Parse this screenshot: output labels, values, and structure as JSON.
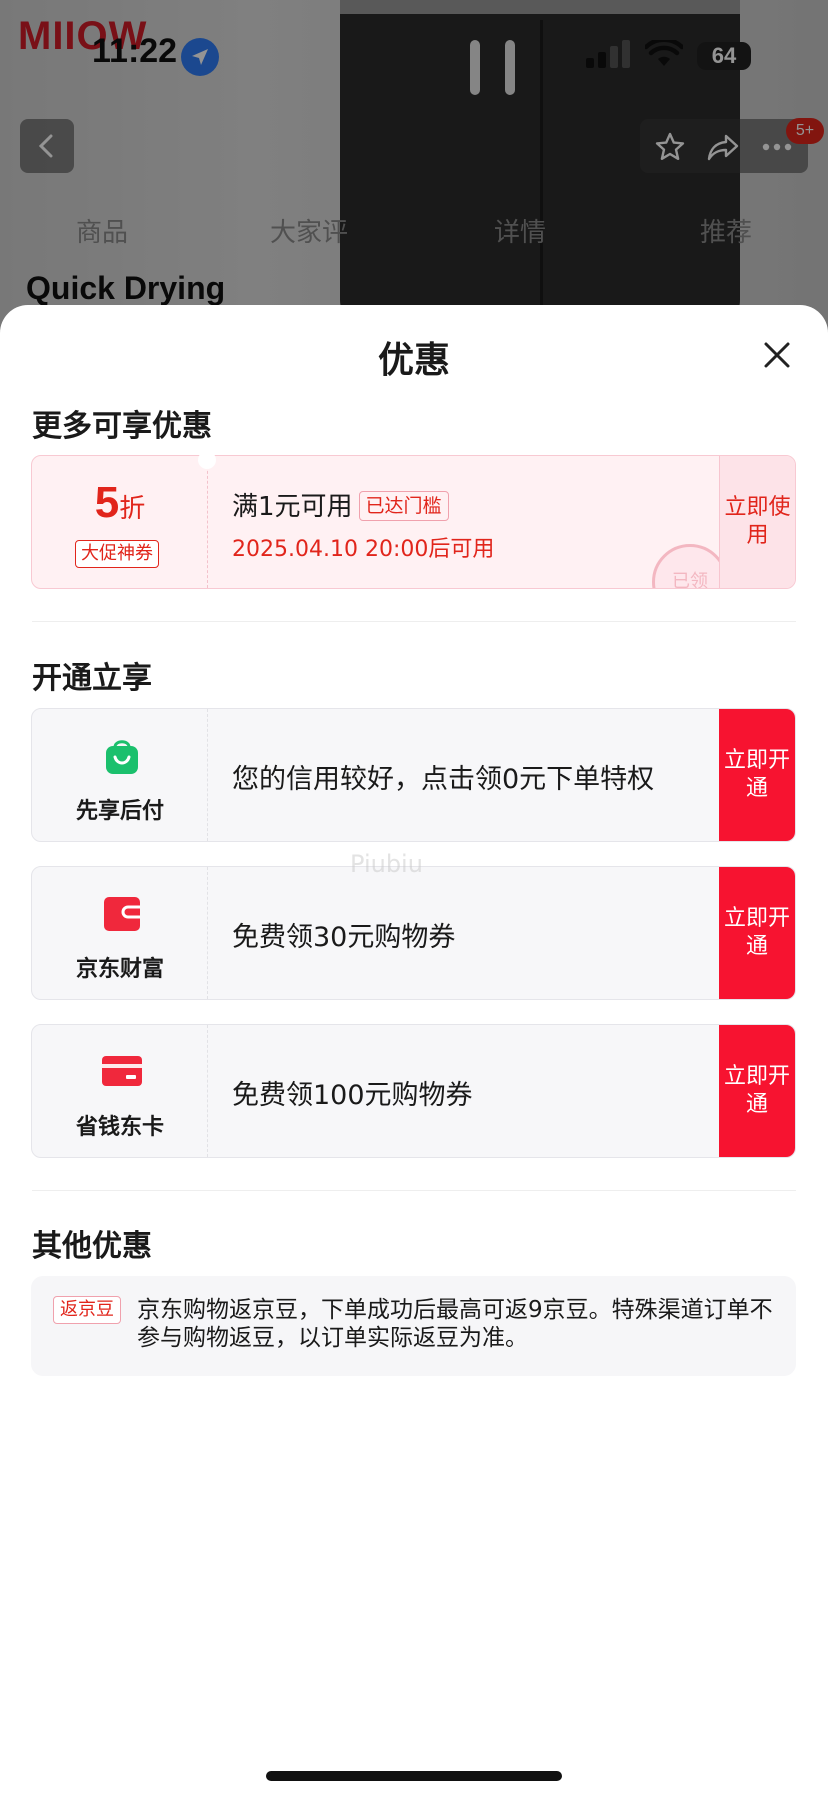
{
  "status_bar": {
    "time": "11:22",
    "battery": "64"
  },
  "background_page": {
    "logo": "MIIOW",
    "tabs": [
      "商品",
      "大家评",
      "详情",
      "推荐"
    ],
    "product_caption": "Quick Drying",
    "cart_badge": "5+"
  },
  "sheet": {
    "title": "优惠",
    "sections": {
      "more_title": "更多可享优惠",
      "open_title": "开通立享",
      "other_title": "其他优惠"
    },
    "coupon": {
      "discount_value": "5",
      "discount_unit": "折",
      "discount_tag": "大促神券",
      "condition": "满1元可用",
      "threshold_tag": "已达门槛",
      "time": "2025.04.10 20:00后可用",
      "action_label": "立即使用",
      "stamp": "已领"
    },
    "services": [
      {
        "name": "先享后付",
        "text": "您的信用较好，点击领0元下单特权",
        "action_label": "立即开通"
      },
      {
        "name": "京东财富",
        "text": "免费领30元购物券",
        "action_label": "立即开通"
      },
      {
        "name": "省钱东卡",
        "text": "免费领100元购物券",
        "action_label": "立即开通"
      }
    ],
    "other": {
      "tag": "返京豆",
      "text": "京东购物返京豆，下单成功后最高可返9京豆。特殊渠道订单不参与购物返豆，以订单实际返豆为准。"
    },
    "watermark": "Piubiu"
  },
  "colors": {
    "accent": "#e1251b",
    "button_red": "#f71330",
    "green": "#1bc06d"
  }
}
